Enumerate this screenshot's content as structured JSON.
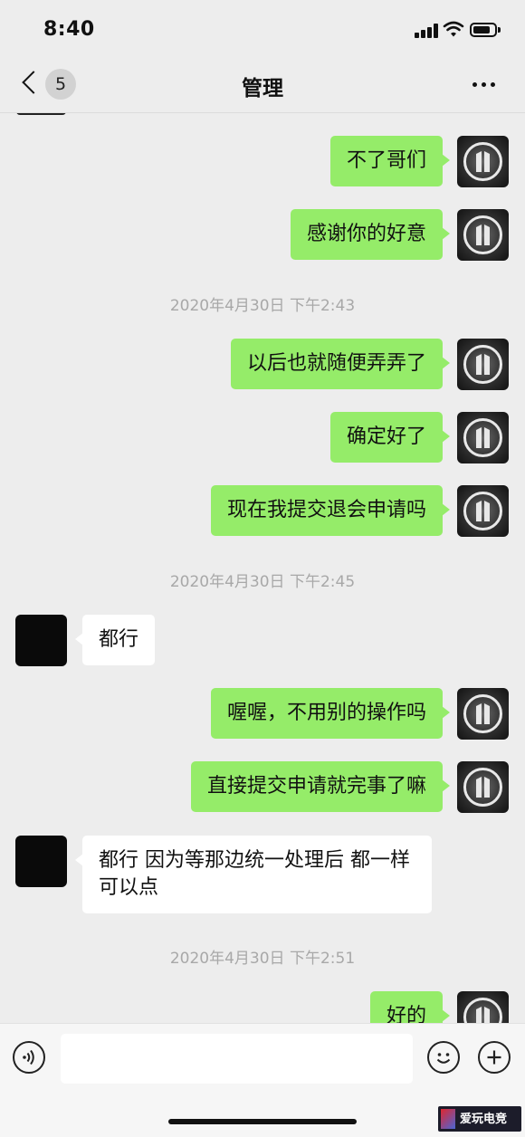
{
  "status_bar": {
    "time": "8:40"
  },
  "nav": {
    "back_count": "5",
    "title": "管理"
  },
  "messages": [
    {
      "type": "me",
      "text": "不了哥们"
    },
    {
      "type": "me",
      "text": "感谢你的好意"
    },
    {
      "type": "time",
      "text": "2020年4月30日 下午2:43"
    },
    {
      "type": "me",
      "text": "以后也就随便弄弄了"
    },
    {
      "type": "me",
      "text": "确定好了"
    },
    {
      "type": "me",
      "text": "现在我提交退会申请吗"
    },
    {
      "type": "time",
      "text": "2020年4月30日 下午2:45"
    },
    {
      "type": "them",
      "text": "都行"
    },
    {
      "type": "me",
      "text": "喔喔，不用别的操作吗"
    },
    {
      "type": "me",
      "text": "直接提交申请就完事了嘛"
    },
    {
      "type": "them",
      "text": "都行 因为等那边统一处理后 都一样可以点"
    },
    {
      "type": "time",
      "text": "2020年4月30日 下午2:51"
    },
    {
      "type": "me",
      "text": "好的"
    }
  ],
  "input": {
    "value": ""
  },
  "icons": {
    "back": "chevron-left-icon",
    "more": "more-dots-icon",
    "voice": "voice-icon",
    "emoji": "emoji-icon",
    "plus": "plus-icon"
  },
  "colors": {
    "bubble_me": "#95ec69",
    "bubble_them": "#ffffff",
    "background": "#ededed"
  },
  "watermark": {
    "brand": "爱玩电竞"
  }
}
